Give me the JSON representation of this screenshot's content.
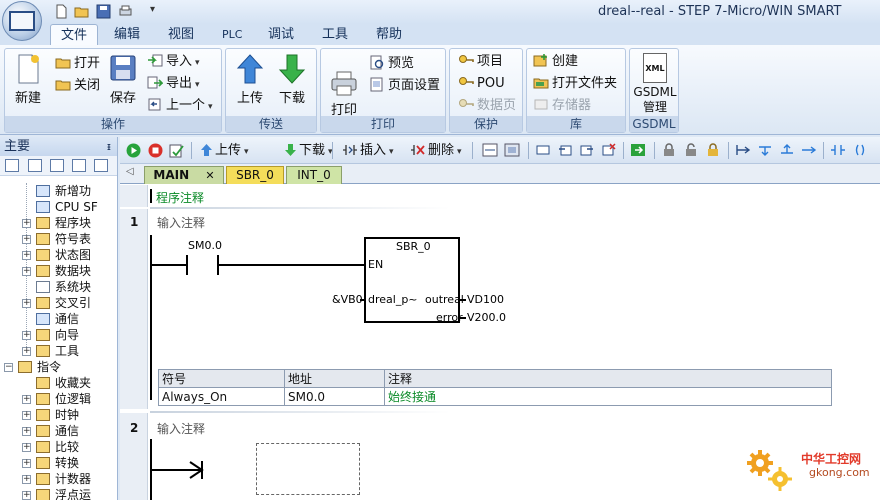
{
  "window": {
    "title": "dreal--real - STEP 7-Micro/WIN SMART"
  },
  "menu": {
    "tabs": [
      {
        "label": "文件"
      },
      {
        "label": "编辑"
      },
      {
        "label": "视图"
      },
      {
        "label": "PLC"
      },
      {
        "label": "调试"
      },
      {
        "label": "工具"
      },
      {
        "label": "帮助"
      }
    ]
  },
  "ribbon": {
    "groups": {
      "operate": "操作",
      "transfer": "传送",
      "print": "打印",
      "protect": "保护",
      "library": "库",
      "gsdml": "GSDML"
    },
    "buttons": {
      "new": "新建",
      "open": "打开",
      "close": "关闭",
      "save": "保存",
      "import": "导入",
      "export": "导出",
      "previous": "上一个",
      "upload": "上传",
      "download": "下载",
      "print": "打印",
      "preview": "预览",
      "page_setup": "页面设置",
      "project": "项目",
      "pou": "POU",
      "data_page": "数据页",
      "create": "创建",
      "open_folder": "打开文件夹",
      "memory": "存储器",
      "gsdml_manage": "GSDML\n管理"
    },
    "xml_badge": "XML"
  },
  "sidebar": {
    "title": "主要",
    "pin": "ᵻ",
    "items": [
      {
        "label": "新增功"
      },
      {
        "label": "CPU SF"
      },
      {
        "label": "程序块"
      },
      {
        "label": "符号表"
      },
      {
        "label": "状态图"
      },
      {
        "label": "数据块"
      },
      {
        "label": "系统块"
      },
      {
        "label": "交叉引"
      },
      {
        "label": "通信"
      },
      {
        "label": "向导"
      },
      {
        "label": "工具"
      },
      {
        "label": "指令"
      },
      {
        "label": "收藏夹"
      },
      {
        "label": "位逻辑"
      },
      {
        "label": "时钟"
      },
      {
        "label": "通信"
      },
      {
        "label": "比较"
      },
      {
        "label": "转换"
      },
      {
        "label": "计数器"
      },
      {
        "label": "浮点运"
      }
    ]
  },
  "toolbar": {
    "upload": "上传",
    "download": "下载",
    "insert": "插入",
    "delete": "删除"
  },
  "doc_tabs": [
    {
      "label": "MAIN",
      "close": "✕"
    },
    {
      "label": "SBR_0"
    },
    {
      "label": "INT_0"
    }
  ],
  "editor": {
    "program_comment": "程序注释",
    "networks": [
      {
        "number": "1",
        "comment": "输入注释",
        "contact_addr": "SM0.0",
        "box_title": "SBR_0",
        "en": "EN",
        "in_param": "dreal_p~",
        "in_value": "&VB0",
        "out1_param": "outreal",
        "out1_value": "VD100",
        "out2_param": "error",
        "out2_value": "V200.0",
        "symbol_table": {
          "headers": [
            "符号",
            "地址",
            "注释"
          ],
          "rows": [
            {
              "symbol": "Always_On",
              "address": "SM0.0",
              "comment": "始终接通"
            }
          ]
        }
      },
      {
        "number": "2",
        "comment": "输入注释"
      }
    ]
  },
  "watermark": {
    "text": "中华工控网",
    "url": "gkong.com"
  },
  "colors": {
    "accent": "#1c4e9c",
    "tab_main": "#c9dba3",
    "tab_sbr": "#f4dd5a",
    "tab_int": "#cfe4a6",
    "comment_green": "#0a8a27"
  }
}
